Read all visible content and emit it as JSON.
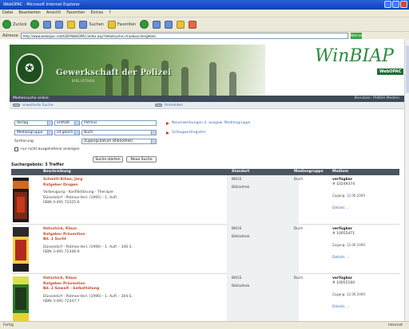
{
  "window": {
    "title": "WebOPAC - Microsoft Internet Explorer"
  },
  "menu": [
    "Datei",
    "Bearbeiten",
    "Ansicht",
    "Favoriten",
    "Extras",
    "?"
  ],
  "toolbar": {
    "back": "Zurück",
    "search": "Suchen",
    "favorites": "Favoriten"
  },
  "address": {
    "label": "Adresse",
    "url": "http://www.webopac.net/GDP/WebOPAC/index.asp?detailsuche=true&suchergebnis",
    "go": "Wechseln zu"
  },
  "banner": {
    "org_name": "Gewerkschaft der Polizei",
    "org_sub": "BIBLIOTHEK",
    "logo_text": "WinBIAP",
    "logo_sub": "WebOPAC"
  },
  "nav": {
    "title": "Mediensuche online",
    "right": "Benutzer: PHBSH Medien"
  },
  "subnav": {
    "search_link": "erweiterte Suche",
    "login_link": "Anmelden"
  },
  "form": {
    "row1": {
      "field": "Verlag",
      "op": "enthält",
      "value": "Patmos"
    },
    "row2": {
      "field": "Mediengruppe",
      "op": "ist gleich",
      "value": "Buch"
    },
    "sort_label": "Sortierung:",
    "sort_value": "Zugangsdatum (Bibliothek)",
    "only_available": "nur nicht ausgeliehene anzeigen",
    "search_button": "Suche starten",
    "new_search_button": "Neue Suche",
    "link_new": "Neuerwerbungen d. ausgew. Mediengruppe",
    "link_keywords": "Schlagwortregister"
  },
  "results_count": "Suchergebnis: 3 Treffer",
  "columns": {
    "desc": "Beschreibung",
    "loc": "Standort",
    "group": "Mediengruppe",
    "status": "Medium"
  },
  "results": [
    {
      "author": "Schmitt-Kilian, Jörg",
      "title": "Ratgeber Drogen",
      "subtitle": "",
      "line1": "Vorbeugung - Konfliktlösung - Therapie",
      "line2": "Düsseldorf : Patmos-Verl. (1995) - 1. Aufl.",
      "line3": "ISBN 3-491-72325-6",
      "sig": "BKGS",
      "lib": "Bibliothek",
      "group": "Buch",
      "avail": "verfügbar",
      "num": "# 10249374",
      "due": "Zugang: 12.06.2009",
      "detail": "Details ..."
    },
    {
      "author": "Hatschick, Klaus",
      "title": "Ratgeber Prävention",
      "subtitle": "Bd. 1 Sucht",
      "line1": "",
      "line2": "Düsseldorf : Patmos-Verl. (1996) - 1. Aufl. - 340 S.",
      "line3": "ISBN 3-491-72346-9",
      "sig": "BKGS",
      "lib": "Bibliothek",
      "group": "Buch",
      "avail": "verfügbar",
      "num": "# 10055471",
      "due": "Zugang: 12.06.2009",
      "detail": "Details ..."
    },
    {
      "author": "Hatschick, Klaus",
      "title": "Ratgeber Prävention",
      "subtitle": "Bd. 2 Gewalt - Selbsttötung",
      "line1": "",
      "line2": "Düsseldorf : Patmos-Verl. (1996) - 1. Aufl. - 304 S.",
      "line3": "ISBN 3-491-72347-7",
      "sig": "BKGS",
      "lib": "Bibliothek",
      "group": "Buch",
      "avail": "verfügbar",
      "num": "# 10055160",
      "due": "Zugang: 12.06.2009",
      "detail": "Details ..."
    }
  ],
  "status": {
    "left": "Fertig",
    "right": "Internet"
  },
  "colors": {
    "accent": "#2a8a3e",
    "link": "#3b6fb6",
    "title_red": "#c04a26",
    "header_dark": "#4b5560"
  }
}
